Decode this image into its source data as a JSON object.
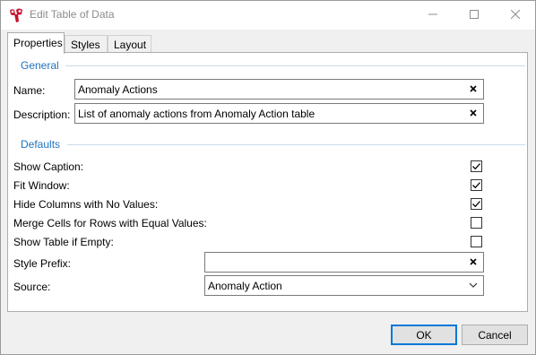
{
  "window": {
    "title": "Edit Table of Data",
    "icon": "app-logo-icon"
  },
  "tabs": [
    {
      "label": "Properties",
      "active": true
    },
    {
      "label": "Styles",
      "active": false
    },
    {
      "label": "Layout",
      "active": false
    }
  ],
  "general": {
    "title": "General",
    "name_label": "Name:",
    "name_value": "Anomaly Actions",
    "description_label": "Description:",
    "description_value": "List of anomaly actions from Anomaly Action table"
  },
  "defaults": {
    "title": "Defaults",
    "options": [
      {
        "label": "Show Caption:",
        "checked": true
      },
      {
        "label": "Fit Window:",
        "checked": true
      },
      {
        "label": "Hide Columns with No Values:",
        "checked": true
      },
      {
        "label": "Merge Cells for Rows with Equal Values:",
        "checked": false
      },
      {
        "label": "Show Table if Empty:",
        "checked": false
      }
    ],
    "style_prefix_label": "Style Prefix:",
    "style_prefix_value": "",
    "source_label": "Source:",
    "source_value": "Anomaly Action"
  },
  "buttons": {
    "ok": "OK",
    "cancel": "Cancel"
  },
  "colors": {
    "accent": "#1e73be",
    "default_button_border": "#0078d7"
  }
}
